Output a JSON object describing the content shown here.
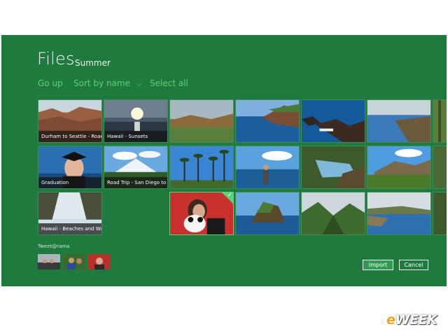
{
  "header": {
    "title": "Files",
    "subtitle": "Summer"
  },
  "commands": {
    "go_up": "Go up",
    "sort": "Sort by name",
    "sort_chevron": "⌵",
    "select_all": "Select all"
  },
  "tiles": {
    "t1": {
      "caption": "Durham to Seattle - Road..."
    },
    "t2": {
      "caption": "Hawaii - Sunsets"
    },
    "t3": {
      "caption": "Graduation"
    },
    "t4": {
      "caption": "Road Trip - San Diego to ..."
    },
    "t5": {
      "caption": "Hawaii - Beaches and Wa..."
    },
    "check": "✓"
  },
  "footer": {
    "tweet_label": "Tweet@rama",
    "import_label": "Import",
    "cancel_label": "Cancel"
  },
  "logo": {
    "e": "e",
    "rest": "WEEK"
  },
  "colors": {
    "background": "#1f7a3e",
    "accent": "#5fd07a",
    "button": "#2f9c51"
  }
}
